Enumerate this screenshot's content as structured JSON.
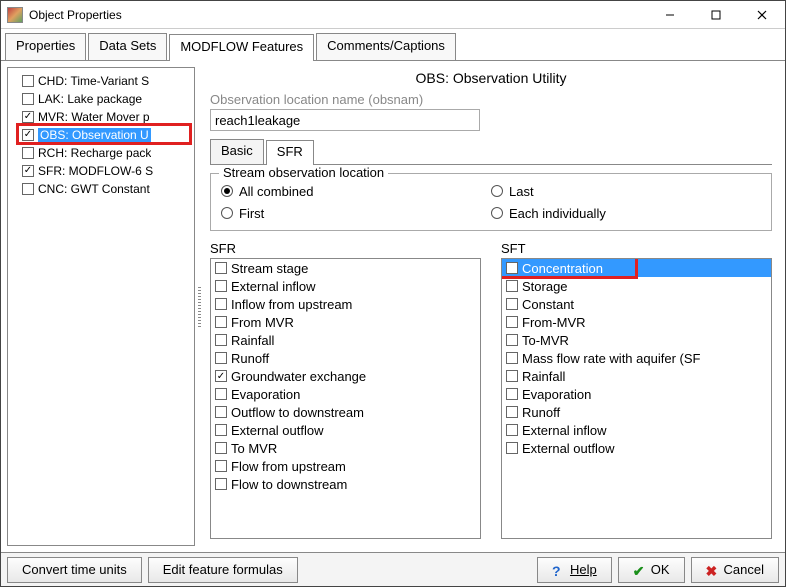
{
  "window": {
    "title": "Object Properties"
  },
  "tabs": [
    "Properties",
    "Data Sets",
    "MODFLOW Features",
    "Comments/Captions"
  ],
  "active_tab": 2,
  "tree": [
    {
      "label": "CHD: Time-Variant S",
      "checked": false
    },
    {
      "label": "LAK: Lake package",
      "checked": false
    },
    {
      "label": "MVR: Water Mover p",
      "checked": true
    },
    {
      "label": "OBS: Observation U",
      "checked": true,
      "selected": true,
      "highlight": true
    },
    {
      "label": "RCH: Recharge pack",
      "checked": false
    },
    {
      "label": "SFR: MODFLOW-6 S",
      "checked": true
    },
    {
      "label": "CNC: GWT Constant",
      "checked": false
    }
  ],
  "obs": {
    "title": "OBS: Observation Utility",
    "obsnam_label": "Observation location name (obsnam)",
    "obsnam_value": "reach1leakage",
    "subtabs": [
      "Basic",
      "SFR"
    ],
    "active_subtab": 1,
    "group_label": "Stream observation location",
    "radios_left": [
      {
        "label": "All combined",
        "checked": true
      },
      {
        "label": "First",
        "checked": false
      }
    ],
    "radios_right": [
      {
        "label": "Last",
        "checked": false
      },
      {
        "label": "Each individually",
        "checked": false
      }
    ],
    "sfr_header": "SFR",
    "sft_header": "SFT",
    "sfr_items": [
      {
        "label": "Stream stage",
        "checked": false
      },
      {
        "label": "External inflow",
        "checked": false
      },
      {
        "label": "Inflow from upstream",
        "checked": false
      },
      {
        "label": "From MVR",
        "checked": false
      },
      {
        "label": "Rainfall",
        "checked": false
      },
      {
        "label": "Runoff",
        "checked": false
      },
      {
        "label": "Groundwater exchange",
        "checked": true
      },
      {
        "label": "Evaporation",
        "checked": false
      },
      {
        "label": "Outflow to downstream",
        "checked": false
      },
      {
        "label": "External outflow",
        "checked": false
      },
      {
        "label": "To MVR",
        "checked": false
      },
      {
        "label": "Flow from upstream",
        "checked": false
      },
      {
        "label": "Flow to downstream",
        "checked": false
      }
    ],
    "sft_items": [
      {
        "label": "Concentration",
        "checked": true,
        "selected": true,
        "highlight": true
      },
      {
        "label": "Storage",
        "checked": false
      },
      {
        "label": "Constant",
        "checked": false
      },
      {
        "label": "From-MVR",
        "checked": false
      },
      {
        "label": "To-MVR",
        "checked": false
      },
      {
        "label": "Mass flow rate with aquifer (SF",
        "checked": false
      },
      {
        "label": "Rainfall",
        "checked": false
      },
      {
        "label": "Evaporation",
        "checked": false
      },
      {
        "label": "Runoff",
        "checked": false
      },
      {
        "label": "External inflow",
        "checked": false
      },
      {
        "label": "External outflow",
        "checked": false
      }
    ]
  },
  "footer": {
    "convert": "Convert time units",
    "edit": "Edit feature formulas",
    "help": "Help",
    "ok": "OK",
    "cancel": "Cancel"
  }
}
